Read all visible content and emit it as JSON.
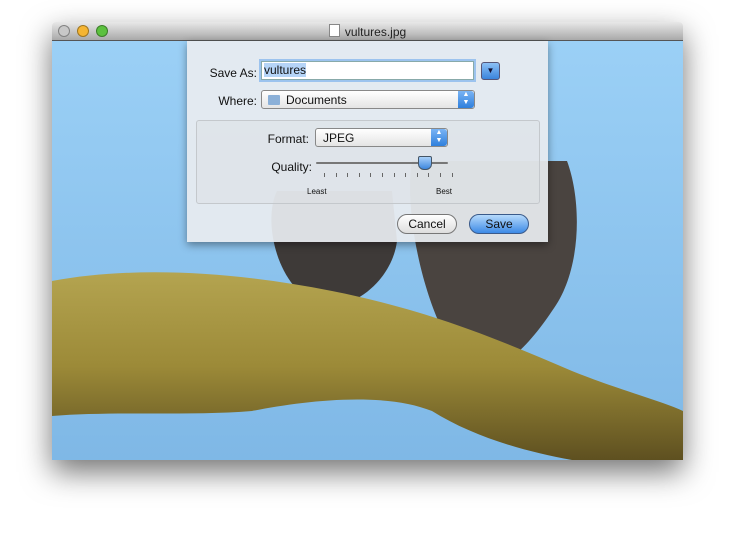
{
  "window": {
    "title": "vultures.jpg",
    "file_icon": "jpeg-file-icon"
  },
  "sheet": {
    "save_as_label": "Save As:",
    "save_as_value": "vultures",
    "where_label": "Where:",
    "where_value": "Documents",
    "where_icon": "folder-icon",
    "format_label": "Format:",
    "format_value": "JPEG",
    "quality_label": "Quality:",
    "quality_min_label": "Least",
    "quality_max_label": "Best",
    "quality_value": 0.8,
    "cancel_label": "Cancel",
    "save_label": "Save"
  },
  "colors": {
    "accent": "#3a8ae6",
    "sky": "#8fc8f2",
    "branch": "#9c8c3c"
  }
}
